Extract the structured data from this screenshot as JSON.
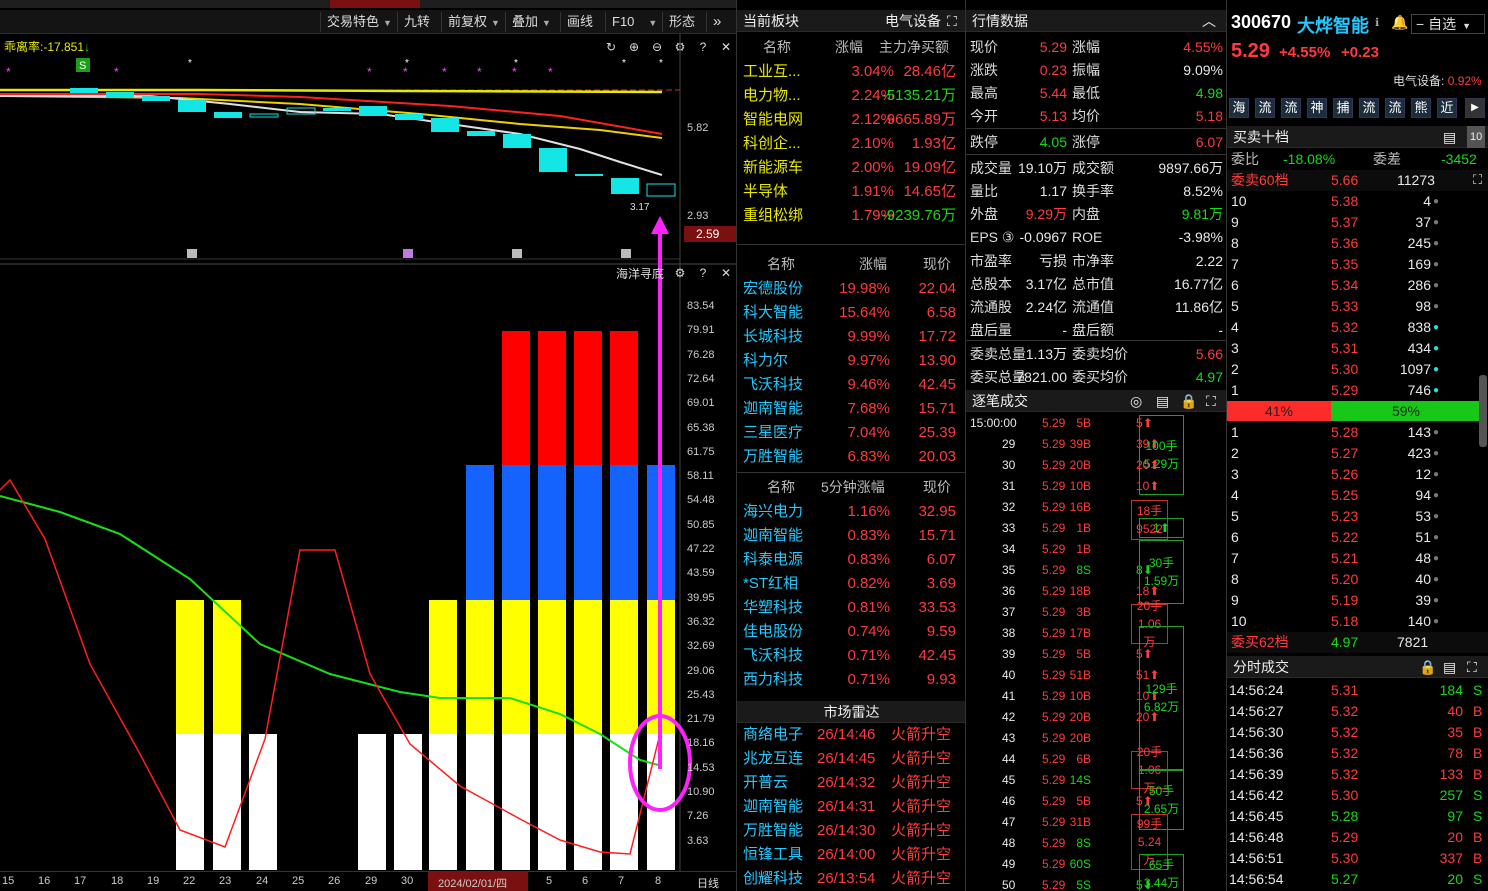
{
  "toolbar": {
    "items": [
      "交易特色",
      "九转",
      "前复权",
      "叠加",
      "画线",
      "F10",
      "形态"
    ]
  },
  "chart": {
    "indicator1": "乖离率:-17.851",
    "indicator2": "海洋寻底",
    "price_axis": [
      "5.82",
      "2.93"
    ],
    "last_price_tag": "2.59",
    "low_label": "3.17",
    "sub_axis": [
      "83.54",
      "79.91",
      "76.28",
      "72.64",
      "69.01",
      "65.38",
      "61.75",
      "58.11",
      "54.48",
      "50.85",
      "47.22",
      "43.59",
      "39.95",
      "36.32",
      "32.69",
      "29.06",
      "25.43",
      "21.79",
      "18.16",
      "14.53",
      "10.90",
      "7.26",
      "3.63"
    ],
    "dates": [
      "15",
      "16",
      "17",
      "18",
      "19",
      "22",
      "23",
      "24",
      "25",
      "26",
      "29",
      "30",
      "2024/02/01/四",
      "5",
      "6",
      "7",
      "8"
    ],
    "period": "日线",
    "s_badge": "S"
  },
  "sector": {
    "title": "当前板块",
    "name": "电气设备",
    "cols": [
      "名称",
      "涨幅",
      "主力净买额"
    ],
    "rows": [
      [
        "工业互...",
        "3.04%",
        "28.46亿"
      ],
      [
        "电力物...",
        "2.24%",
        "-5135.21万"
      ],
      [
        "智能电网",
        "2.12%",
        "9665.89万"
      ],
      [
        "科创企...",
        "2.10%",
        "1.93亿"
      ],
      [
        "新能源车",
        "2.00%",
        "19.09亿"
      ],
      [
        "半导体",
        "1.91%",
        "14.65亿"
      ],
      [
        "重组松绑",
        "1.79%",
        "-9239.76万"
      ]
    ]
  },
  "stocks1": {
    "cols": [
      "名称",
      "涨幅",
      "现价"
    ],
    "rows": [
      [
        "宏德股份",
        "19.98%",
        "22.04"
      ],
      [
        "科大智能",
        "15.64%",
        "6.58"
      ],
      [
        "长城科技",
        "9.99%",
        "17.72"
      ],
      [
        "科力尔",
        "9.97%",
        "13.90"
      ],
      [
        "飞沃科技",
        "9.46%",
        "42.45"
      ],
      [
        "迦南智能",
        "7.68%",
        "15.71"
      ],
      [
        "三星医疗",
        "7.04%",
        "25.39"
      ],
      [
        "万胜智能",
        "6.83%",
        "20.03"
      ]
    ]
  },
  "stocks2": {
    "cols": [
      "名称",
      "5分钟涨幅",
      "现价"
    ],
    "rows": [
      [
        "海兴电力",
        "1.16%",
        "32.95"
      ],
      [
        "迦南智能",
        "0.83%",
        "15.71"
      ],
      [
        "科泰电源",
        "0.83%",
        "6.07"
      ],
      [
        "*ST红相",
        "0.82%",
        "3.69"
      ],
      [
        "华塑科技",
        "0.81%",
        "33.53"
      ],
      [
        "佳电股份",
        "0.74%",
        "9.59"
      ],
      [
        "飞沃科技",
        "0.71%",
        "42.45"
      ],
      [
        "西力科技",
        "0.71%",
        "9.93"
      ]
    ]
  },
  "radar": {
    "title": "市场雷达",
    "rows": [
      [
        "商络电子",
        "26/14:46",
        "火箭升空"
      ],
      [
        "兆龙互连",
        "26/14:45",
        "火箭升空"
      ],
      [
        "开普云",
        "26/14:32",
        "火箭升空"
      ],
      [
        "迦南智能",
        "26/14:31",
        "火箭升空"
      ],
      [
        "万胜智能",
        "26/14:30",
        "火箭升空"
      ],
      [
        "恒锋工具",
        "26/14:00",
        "火箭升空"
      ],
      [
        "创耀科技",
        "26/13:54",
        "火箭升空"
      ]
    ]
  },
  "quote": {
    "title": "行情数据",
    "rows": [
      [
        "现价",
        "5.29",
        "涨幅",
        "4.55%"
      ],
      [
        "涨跌",
        "0.23",
        "振幅",
        "9.09%"
      ],
      [
        "最高",
        "5.44",
        "最低",
        "4.98"
      ],
      [
        "今开",
        "5.13",
        "均价",
        "5.18"
      ],
      [
        "跌停",
        "4.05",
        "涨停",
        "6.07"
      ],
      [
        "成交量",
        "19.10万",
        "成交额",
        "9897.66万"
      ],
      [
        "量比",
        "1.17",
        "换手率",
        "8.52%"
      ],
      [
        "外盘",
        "9.29万",
        "内盘",
        "9.81万"
      ],
      [
        "EPS ③",
        "-0.0967",
        "ROE",
        "-3.98%"
      ],
      [
        "市盈率",
        "亏损",
        "市净率",
        "2.22"
      ],
      [
        "总股本",
        "3.17亿",
        "总市值",
        "16.77亿"
      ],
      [
        "流通股",
        "2.24亿",
        "流通值",
        "11.86亿"
      ],
      [
        "盘后量",
        "-",
        "盘后额",
        "-"
      ],
      [
        "委卖总量",
        "1.13万",
        "委卖均价",
        "5.66"
      ],
      [
        "委买总量",
        "7821.00",
        "委买均价",
        "4.97"
      ]
    ]
  },
  "ticks": {
    "title": "逐笔成交",
    "rows": [
      [
        "15:00:00",
        "5.29",
        "5B",
        "5"
      ],
      [
        "29",
        "5.29",
        "39B",
        "39"
      ],
      [
        "30",
        "5.29",
        "20B",
        "20"
      ],
      [
        "31",
        "5.29",
        "10B",
        "10"
      ],
      [
        "32",
        "5.29",
        "16B",
        ""
      ],
      [
        "33",
        "5.29",
        "1B",
        ""
      ],
      [
        "34",
        "5.29",
        "1B",
        ""
      ],
      [
        "35",
        "5.29",
        "8S",
        "8"
      ],
      [
        "36",
        "5.29",
        "18B",
        "18"
      ],
      [
        "37",
        "5.29",
        "3B",
        ""
      ],
      [
        "38",
        "5.29",
        "17B",
        ""
      ],
      [
        "39",
        "5.29",
        "5B",
        "5"
      ],
      [
        "40",
        "5.29",
        "51B",
        "51"
      ],
      [
        "41",
        "5.29",
        "10B",
        "10"
      ],
      [
        "42",
        "5.29",
        "20B",
        "20"
      ],
      [
        "43",
        "5.29",
        "20B",
        ""
      ],
      [
        "44",
        "5.29",
        "6B",
        ""
      ],
      [
        "45",
        "5.29",
        "14S",
        ""
      ],
      [
        "46",
        "5.29",
        "5B",
        "5"
      ],
      [
        "47",
        "5.29",
        "31B",
        ""
      ],
      [
        "48",
        "5.29",
        "8S",
        ""
      ],
      [
        "49",
        "5.29",
        "60S",
        ""
      ],
      [
        "50",
        "5.29",
        "5S",
        "5"
      ]
    ],
    "boxes": [
      [
        "100手",
        "5.29万"
      ],
      [
        "18手",
        "9522"
      ],
      [
        "1"
      ],
      [
        "30手",
        "1.59万"
      ],
      [
        "20手",
        "1.06万"
      ],
      [
        "129手",
        "6.82万"
      ],
      [
        "20手",
        "1.06万"
      ],
      [
        "50手",
        "2.65万"
      ],
      [
        "99手",
        "5.24万"
      ],
      [
        "65手",
        "3.44万"
      ]
    ]
  },
  "stock": {
    "code": "300670",
    "name": "大烨智能",
    "price": "5.29",
    "chg_pct": "+4.55%",
    "chg": "+0.23",
    "sector": "电气设备:",
    "sector_pct": "0.92%",
    "watch": "自选",
    "tabs": [
      "海",
      "流",
      "流",
      "神",
      "捕",
      "流",
      "流",
      "熊",
      "近"
    ]
  },
  "book": {
    "title": "买卖十档",
    "wb_label": "委比",
    "wb": "-18.08%",
    "wc_label": "委差",
    "wc": "-3452",
    "ask_hdr": [
      "委卖60档",
      "5.66",
      "11273"
    ],
    "asks": [
      [
        "10",
        "5.38",
        "4"
      ],
      [
        "9",
        "5.37",
        "37"
      ],
      [
        "8",
        "5.36",
        "245"
      ],
      [
        "7",
        "5.35",
        "169"
      ],
      [
        "6",
        "5.34",
        "286"
      ],
      [
        "5",
        "5.33",
        "98"
      ],
      [
        "4",
        "5.32",
        "838"
      ],
      [
        "3",
        "5.31",
        "434"
      ],
      [
        "2",
        "5.30",
        "1097"
      ],
      [
        "1",
        "5.29",
        "746"
      ]
    ],
    "ratio": [
      "41%",
      "59%"
    ],
    "bids": [
      [
        "1",
        "5.28",
        "143"
      ],
      [
        "2",
        "5.27",
        "423"
      ],
      [
        "3",
        "5.26",
        "12"
      ],
      [
        "4",
        "5.25",
        "94"
      ],
      [
        "5",
        "5.23",
        "53"
      ],
      [
        "6",
        "5.22",
        "51"
      ],
      [
        "7",
        "5.21",
        "48"
      ],
      [
        "8",
        "5.20",
        "40"
      ],
      [
        "9",
        "5.19",
        "39"
      ],
      [
        "10",
        "5.18",
        "140"
      ]
    ],
    "bid_hdr": [
      "委买62档",
      "4.97",
      "7821"
    ]
  },
  "trades": {
    "title": "分时成交",
    "rows": [
      [
        "14:56:24",
        "5.31",
        "184",
        "S"
      ],
      [
        "14:56:27",
        "5.32",
        "40",
        "B"
      ],
      [
        "14:56:30",
        "5.32",
        "35",
        "B"
      ],
      [
        "14:56:36",
        "5.32",
        "78",
        "B"
      ],
      [
        "14:56:39",
        "5.32",
        "133",
        "B"
      ],
      [
        "14:56:42",
        "5.30",
        "257",
        "S"
      ],
      [
        "14:56:45",
        "5.28",
        "97",
        "S"
      ],
      [
        "14:56:48",
        "5.29",
        "20",
        "B"
      ],
      [
        "14:56:51",
        "5.30",
        "337",
        "B"
      ],
      [
        "14:56:54",
        "5.27",
        "20",
        "S"
      ]
    ]
  }
}
